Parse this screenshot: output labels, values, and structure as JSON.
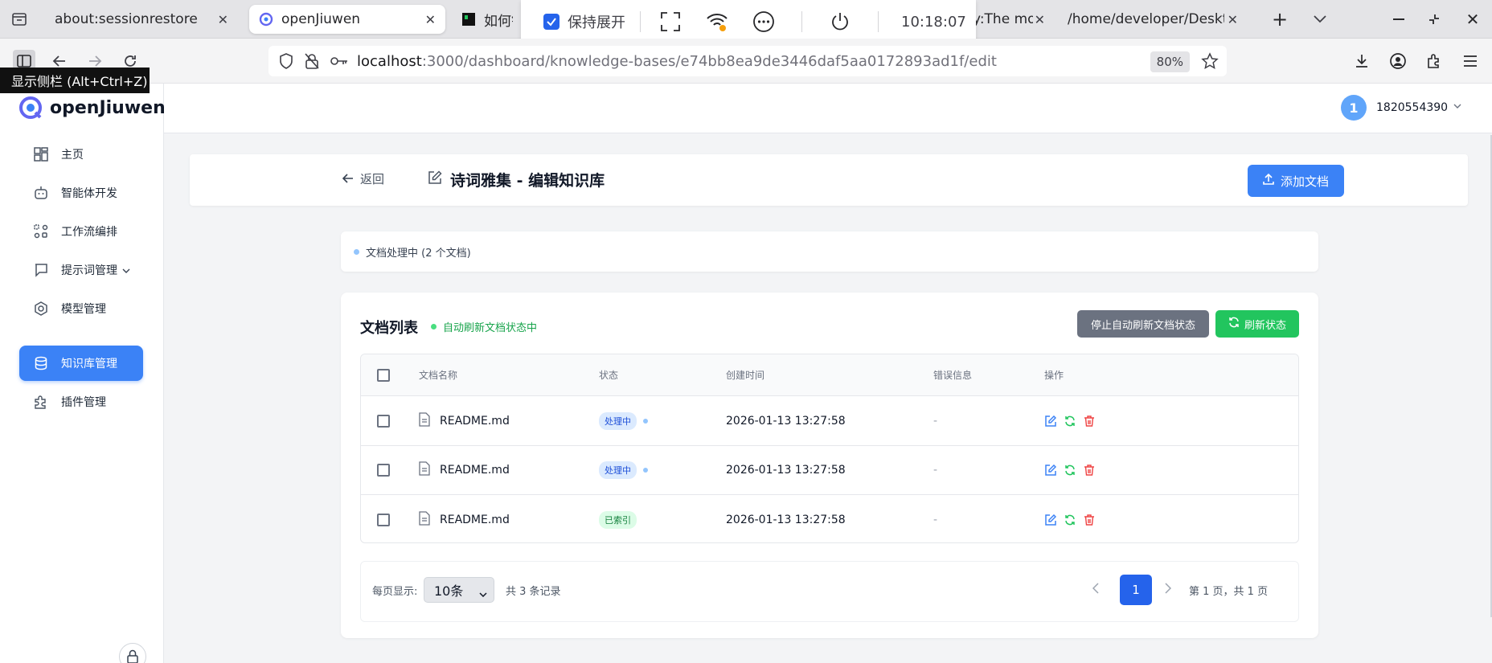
{
  "browser": {
    "tabs": [
      {
        "title": "about:sessionrestore",
        "active": false
      },
      {
        "title": "openJiuwen",
        "active": true
      },
      {
        "title": "如何针",
        "active": false
      },
      {
        "title": "y:The mo",
        "active": false
      },
      {
        "title": "/home/developer/Desktop",
        "active": false
      }
    ],
    "overlay": {
      "keep_expanded": "保持展开",
      "time": "10:18:07"
    },
    "url": {
      "host": "localhost",
      "path": ":3000/dashboard/knowledge-bases/e74bb8ea9de3446daf5aa0172893ad1f/edit"
    },
    "zoom": "80%",
    "tooltip": "显示侧栏 (Alt+Ctrl+Z)"
  },
  "app": {
    "brand": "openJiuwen",
    "accent": "#3b82f6",
    "sidebar": [
      {
        "label": "主页",
        "icon": "dashboard-icon"
      },
      {
        "label": "智能体开发",
        "icon": "bot-icon"
      },
      {
        "label": "工作流编排",
        "icon": "workflow-icon"
      },
      {
        "label": "提示词管理",
        "icon": "message-square-icon",
        "has_submenu": true
      },
      {
        "label": "模型管理",
        "icon": "model-icon"
      },
      {
        "label": "知识库管理",
        "icon": "database-icon",
        "active": true
      },
      {
        "label": "插件管理",
        "icon": "puzzle-icon"
      }
    ],
    "user": {
      "avatar": "1",
      "name": "1820554390"
    }
  },
  "page": {
    "back": "返回",
    "title": "诗词雅集 - 编辑知识库",
    "add_doc": "添加文档",
    "processing_status": "文档处理中 (2 个文档)",
    "list": {
      "title": "文档列表",
      "auto_refresh": "自动刷新文档状态中",
      "stop_btn": "停止自动刷新文档状态",
      "refresh_btn": "刷新状态",
      "columns": [
        "文档名称",
        "状态",
        "创建时间",
        "错误信息",
        "操作"
      ],
      "rows": [
        {
          "name": "README.md",
          "status": "处理中",
          "created": "2026-01-13 13:27:58",
          "error": "-"
        },
        {
          "name": "README.md",
          "status": "处理中",
          "created": "2026-01-13 13:27:58",
          "error": "-"
        },
        {
          "name": "README.md",
          "status": "已索引",
          "created": "2026-01-13 13:27:58",
          "error": "-"
        }
      ]
    },
    "pagination": {
      "per_page_label": "每页显示:",
      "per_page_value": "10条",
      "total": "共 3 条记录",
      "current_page": "1",
      "summary": "第 1 页，共 1 页"
    }
  }
}
